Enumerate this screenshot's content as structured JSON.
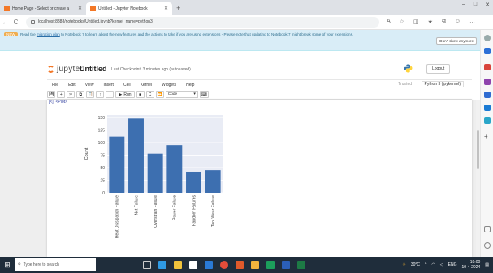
{
  "browser": {
    "tabs": [
      {
        "title": "Home Page - Select or create a",
        "favicon_color": "#f37726",
        "active": false
      },
      {
        "title": "Untitled - Jupyter Notebook",
        "favicon_color": "#f37726",
        "active": true
      }
    ],
    "new_tab": "+",
    "window_controls": [
      "–",
      "□",
      "✕"
    ],
    "url": "localhost:8888/notebooks/Untitled.ipynb?kernel_name=python3",
    "nav": {
      "back": "←",
      "reload": "C"
    }
  },
  "banner": {
    "badge": "NEW",
    "text_before": "Read the",
    "link": "migration plan",
    "text_after": "to Notebook 7 to learn about the new features and the actions to take if you are using extensions - Please note that updating to Notebook 7 might break some of your extensions.",
    "button": "Don't show anymore"
  },
  "jupyter": {
    "logo_text": "jupyter",
    "notebook_title": "Untitled",
    "checkpoint": "Last Checkpoint: 3 minutes ago  (autosaved)",
    "logout": "Logout",
    "menus": [
      "File",
      "Edit",
      "View",
      "Insert",
      "Cell",
      "Kernel",
      "Widgets",
      "Help"
    ],
    "kernel_status": "Trusted",
    "kernel_name": "Python 3 (ipykernel)",
    "toolbar": {
      "save": "💾",
      "add": "+",
      "cut": "✂",
      "copy": "⧉",
      "paste": "📋",
      "up": "↑",
      "down": "↓",
      "run": "Run",
      "stop": "■",
      "restart": "C",
      "fast_forward": "⏩",
      "cell_type": "Code",
      "keyboard": "⌨"
    },
    "output_prompt": "[<]: <Plot>"
  },
  "chart_data": {
    "type": "bar",
    "categories": [
      "Heat Dissipation Failure",
      "Net Failure",
      "Overstrain Failure",
      "Power Failure",
      "Random Failures",
      "Tool Wear Failure"
    ],
    "values": [
      112,
      148,
      78,
      95,
      42,
      45
    ],
    "ylabel": "Count",
    "yticks": [
      0,
      25,
      50,
      75,
      100,
      125,
      150
    ],
    "ylim": [
      0,
      155
    ],
    "bar_color": "#3d6fb0",
    "plot_bg": "#e9ecf5"
  },
  "taskbar": {
    "search_placeholder": "Type here to search",
    "weather": "30°C",
    "lang": "ENG",
    "time": "19:00",
    "date": "10-4-2024"
  }
}
